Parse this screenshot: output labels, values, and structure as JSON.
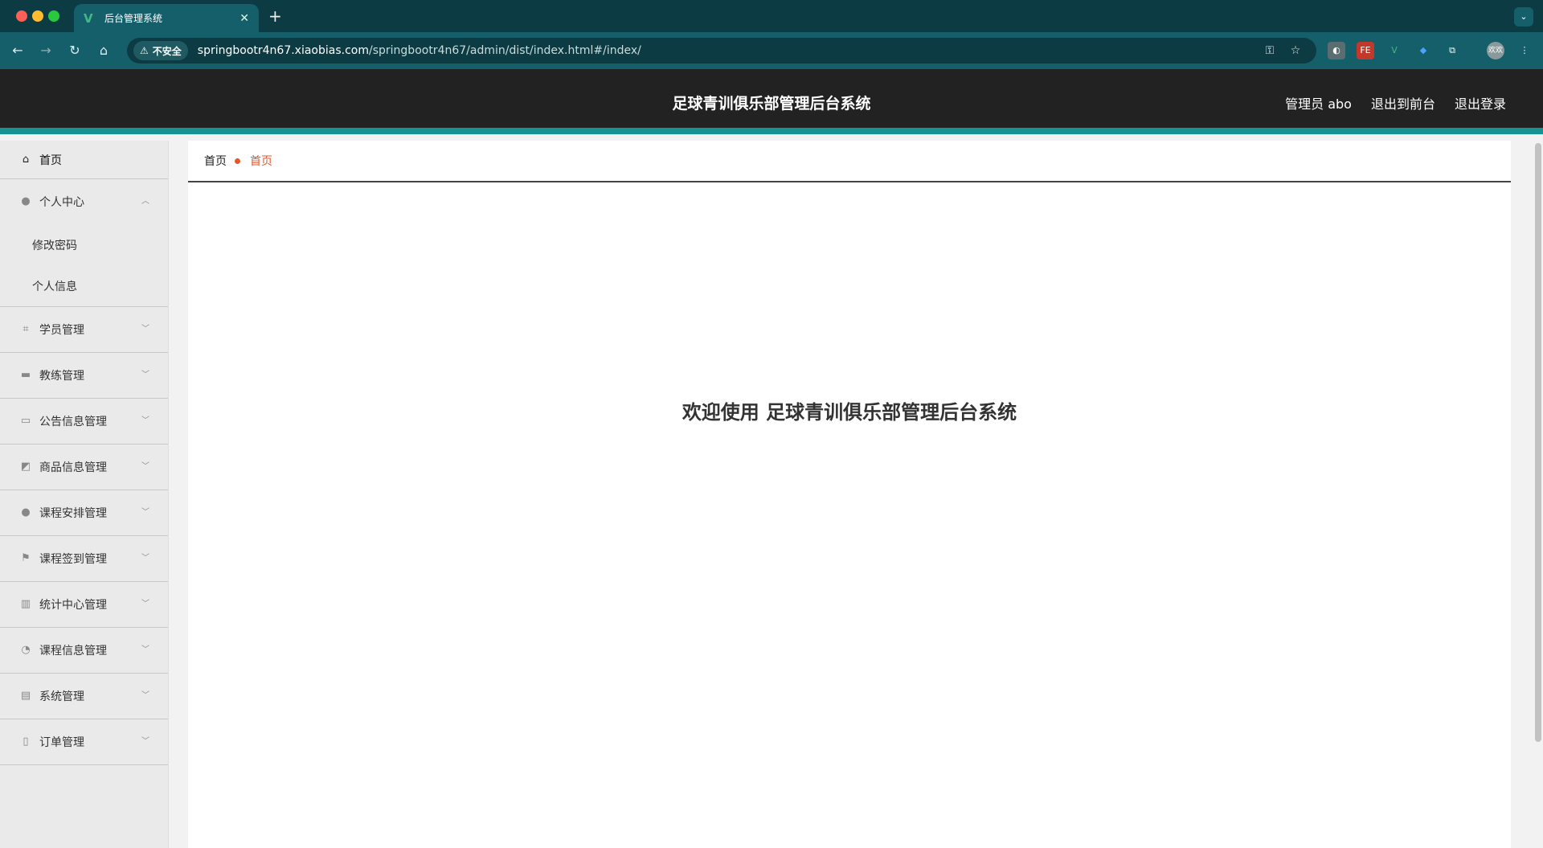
{
  "browser": {
    "tab_title": "后台管理系统",
    "tab_logo": "V",
    "tab_close": "✕",
    "new_tab": "+",
    "security_label": "不安全",
    "url_host": "springbootr4n67.xiaobias.com",
    "url_path": "/springbootr4n67/admin/dist/index.html#/index/",
    "icons": [
      "back-icon",
      "forward-icon",
      "reload-icon",
      "home-icon",
      "key-icon",
      "star-icon",
      "extensions-icon",
      "profile-icon"
    ],
    "profile_label": "欢欢"
  },
  "header": {
    "title": "足球青训俱乐部管理后台系统",
    "user_label": "管理员 abo",
    "front_link": "退出到前台",
    "logout_link": "退出登录",
    "accent_color": "#159393"
  },
  "sidebar": {
    "home": "首页",
    "personal": {
      "label": "个人中心",
      "children": [
        "修改密码",
        "个人信息"
      ]
    },
    "items": [
      {
        "label": "学员管理",
        "icon": "crop-icon"
      },
      {
        "label": "教练管理",
        "icon": "briefcase-icon"
      },
      {
        "label": "公告信息管理",
        "icon": "card-icon"
      },
      {
        "label": "商品信息管理",
        "icon": "chart-icon"
      },
      {
        "label": "课程安排管理",
        "icon": "user-icon"
      },
      {
        "label": "课程签到管理",
        "icon": "flag-icon"
      },
      {
        "label": "统计中心管理",
        "icon": "bars-icon"
      },
      {
        "label": "课程信息管理",
        "icon": "gauge-icon"
      },
      {
        "label": "系统管理",
        "icon": "clipboard-icon"
      },
      {
        "label": "订单管理",
        "icon": "mic-icon"
      }
    ]
  },
  "breadcrumb": {
    "home": "首页",
    "current": "首页",
    "current_color": "#e4572e"
  },
  "main": {
    "welcome": "欢迎使用 足球青训俱乐部管理后台系统"
  }
}
